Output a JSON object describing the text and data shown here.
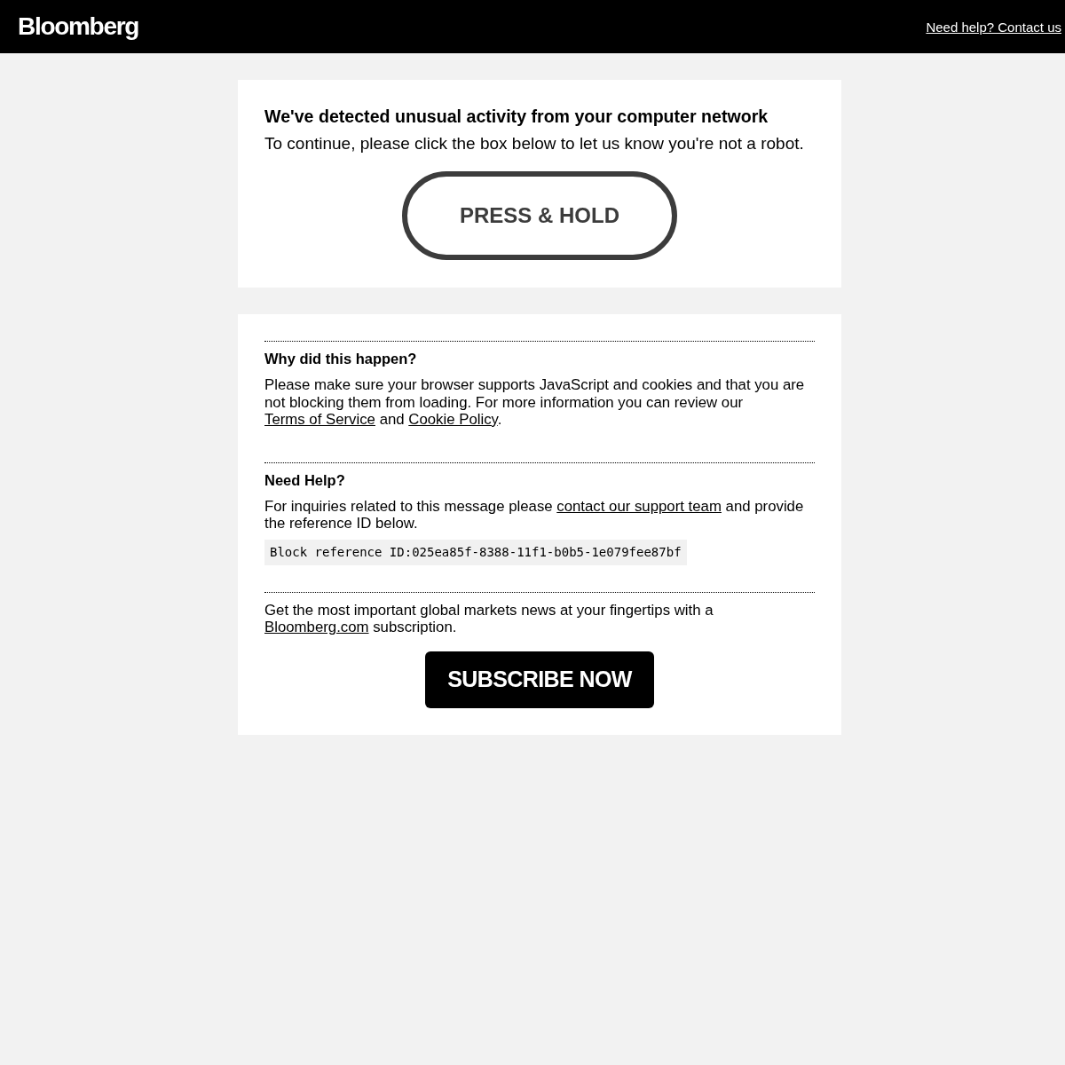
{
  "header": {
    "logo": "Bloomberg",
    "help_link": "Need help? Contact us"
  },
  "challenge": {
    "title": "We've detected unusual activity from your computer network",
    "instruction": "To continue, please click the box below to let us know you're not a robot.",
    "button": "PRESS & HOLD"
  },
  "info": {
    "sections": [
      {
        "heading": "Why did this happen?",
        "paragraph": [
          {
            "kind": "text",
            "text": "Please make sure your browser supports JavaScript and cookies and that you are not blocking them from loading. For more information you can review our "
          },
          {
            "kind": "link",
            "text": "Terms of Service"
          },
          {
            "kind": "text",
            "text": " and "
          },
          {
            "kind": "link",
            "text": "Cookie Policy"
          },
          {
            "kind": "text",
            "text": "."
          }
        ]
      },
      {
        "heading": "Need Help?",
        "paragraph": [
          {
            "kind": "text",
            "text": "For inquiries related to this message please "
          },
          {
            "kind": "link",
            "text": "contact our support team"
          },
          {
            "kind": "text",
            "text": " and provide the reference ID below."
          }
        ],
        "reference": "Block reference ID:025ea85f-8388-11f1-b0b5-1e079fee87bf"
      },
      {
        "paragraph": [
          {
            "kind": "text",
            "text": "Get the most important global markets news at your fingertips with a "
          },
          {
            "kind": "link",
            "text": "Bloomberg.com"
          },
          {
            "kind": "text",
            "text": " subscription."
          }
        ],
        "button": "SUBSCRIBE NOW"
      }
    ]
  }
}
